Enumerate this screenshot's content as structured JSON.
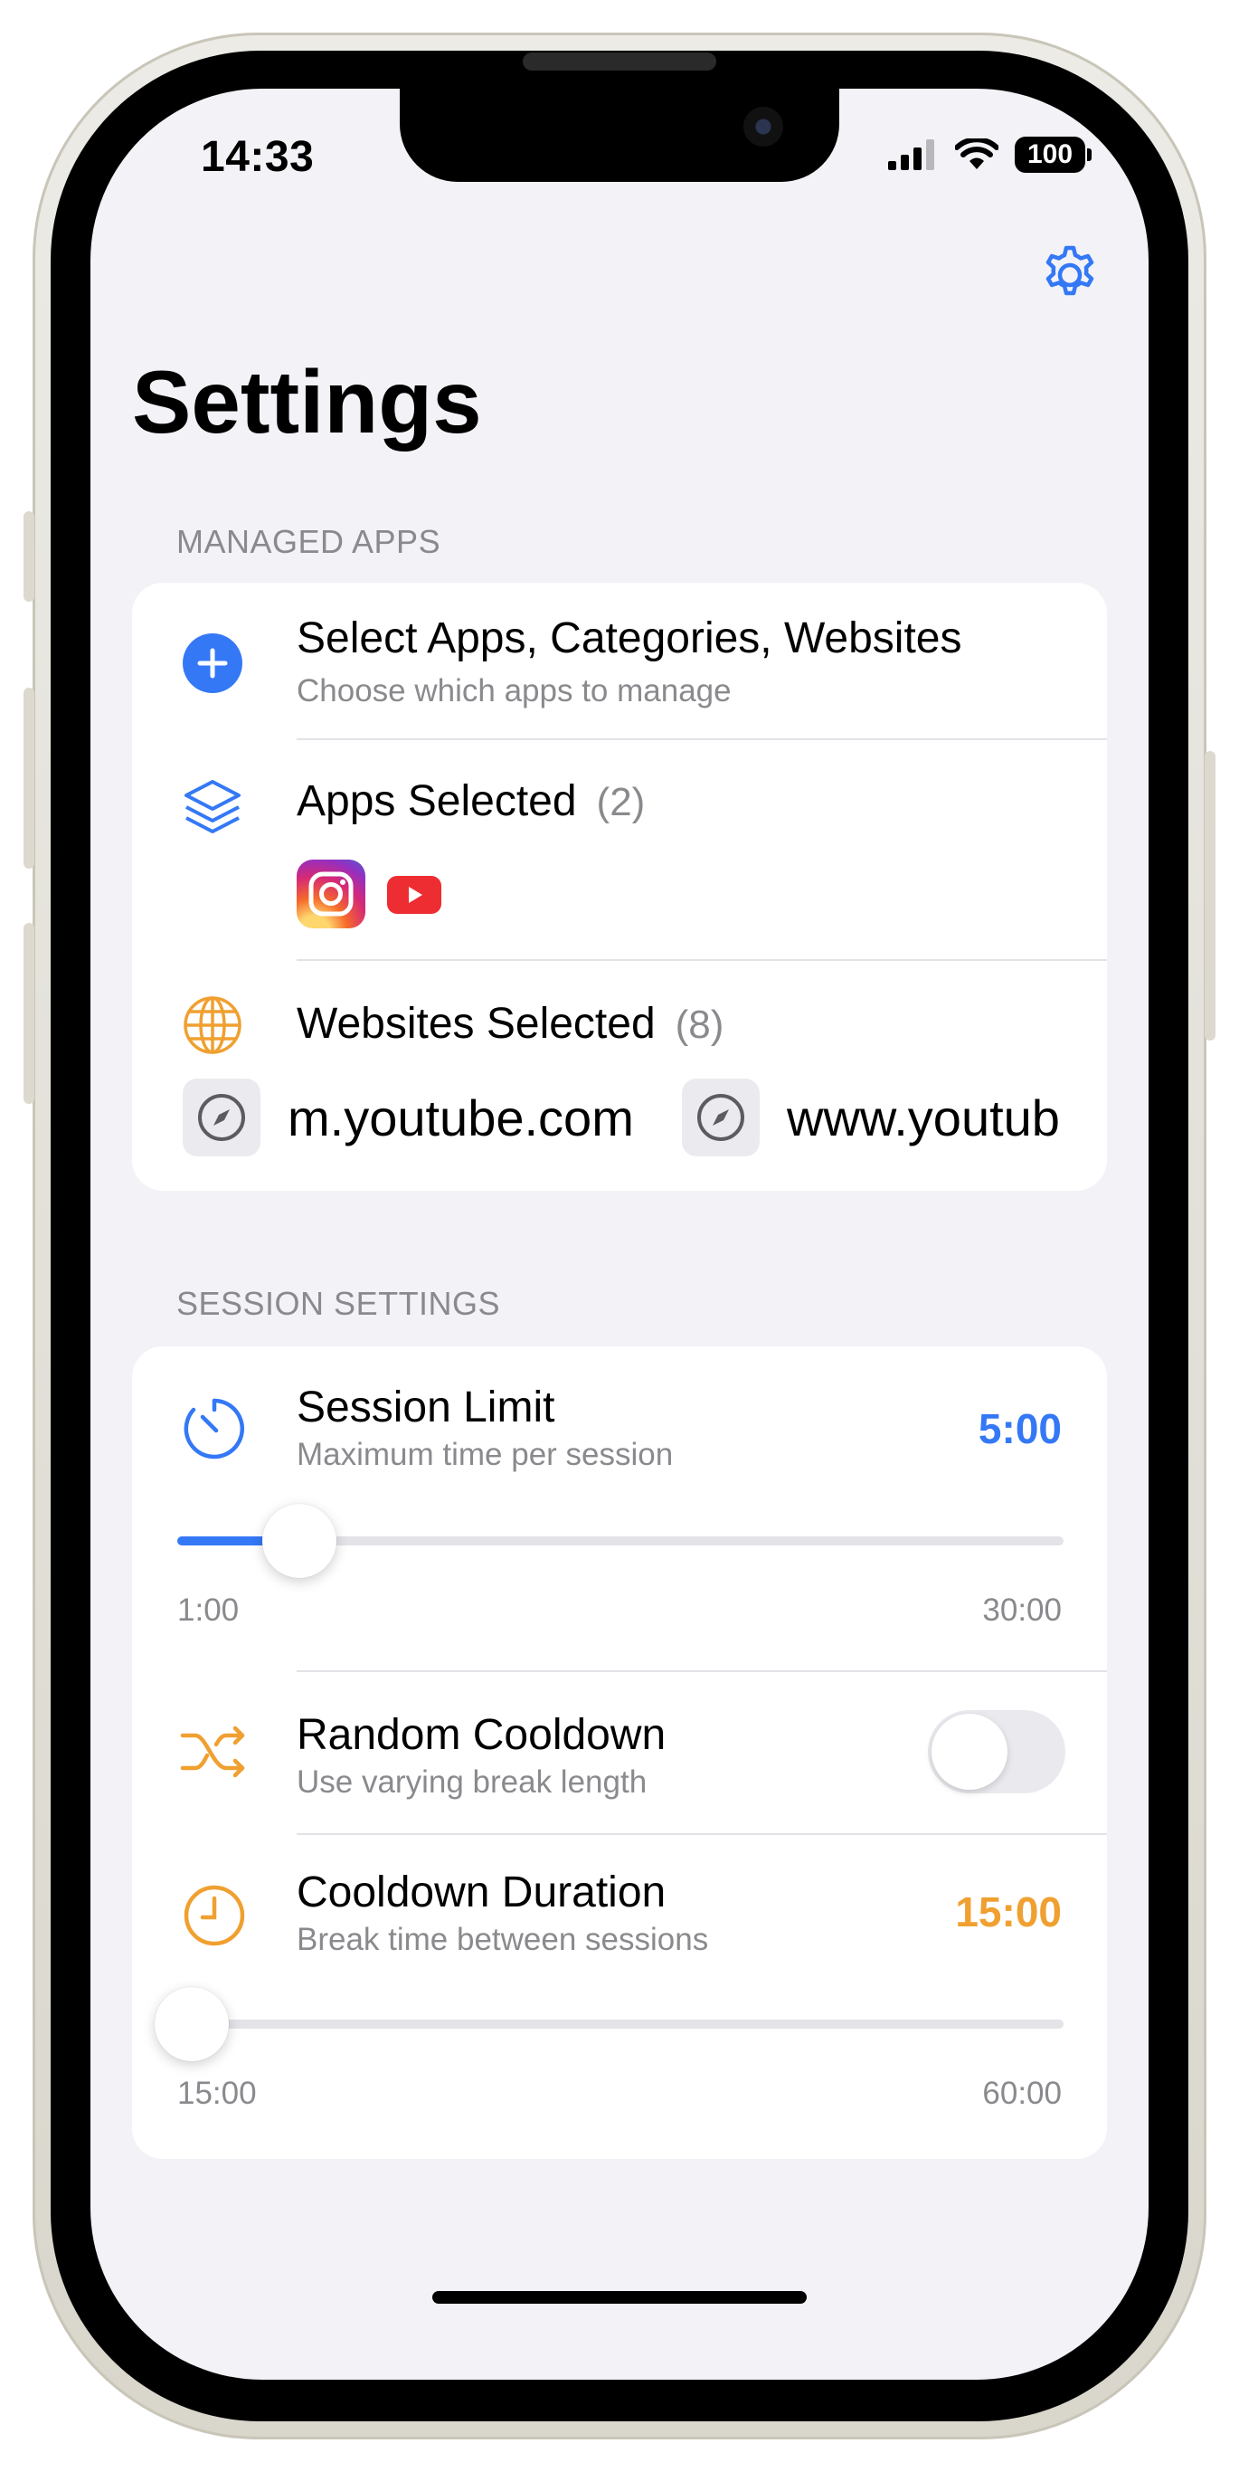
{
  "status_bar": {
    "time": "14:33",
    "battery": "100"
  },
  "header": {
    "title": "Settings",
    "settings_icon": "gear-icon"
  },
  "colors": {
    "blue": "#3478f6",
    "orange": "#f0a030",
    "gray_text": "#8a8a8e"
  },
  "managed_apps": {
    "header": "MANAGED APPS",
    "select": {
      "title": "Select Apps, Categories, Websites",
      "subtitle": "Choose which apps to manage",
      "icon": "plus-circle-icon"
    },
    "apps": {
      "title": "Apps Selected",
      "count": "(2)",
      "icon": "layers-icon",
      "items": [
        "instagram-icon",
        "youtube-icon"
      ]
    },
    "websites": {
      "title": "Websites Selected",
      "count": "(8)",
      "icon": "globe-icon",
      "items": [
        {
          "label": "m.youtube.com",
          "icon": "compass-icon"
        },
        {
          "label": "www.youtub",
          "icon": "compass-icon"
        }
      ]
    }
  },
  "session_settings": {
    "header": "SESSION SETTINGS",
    "session_limit": {
      "title": "Session Limit",
      "subtitle": "Maximum time per session",
      "value": "5:00",
      "min": "1:00",
      "max": "30:00",
      "fraction": 0.138,
      "icon": "timer-icon"
    },
    "random_cooldown": {
      "title": "Random Cooldown",
      "subtitle": "Use varying break length",
      "enabled": false,
      "icon": "shuffle-icon"
    },
    "cooldown_duration": {
      "title": "Cooldown Duration",
      "subtitle": "Break time between sessions",
      "value": "15:00",
      "min": "15:00",
      "max": "60:00",
      "fraction": 0.0,
      "icon": "clock-icon"
    }
  }
}
